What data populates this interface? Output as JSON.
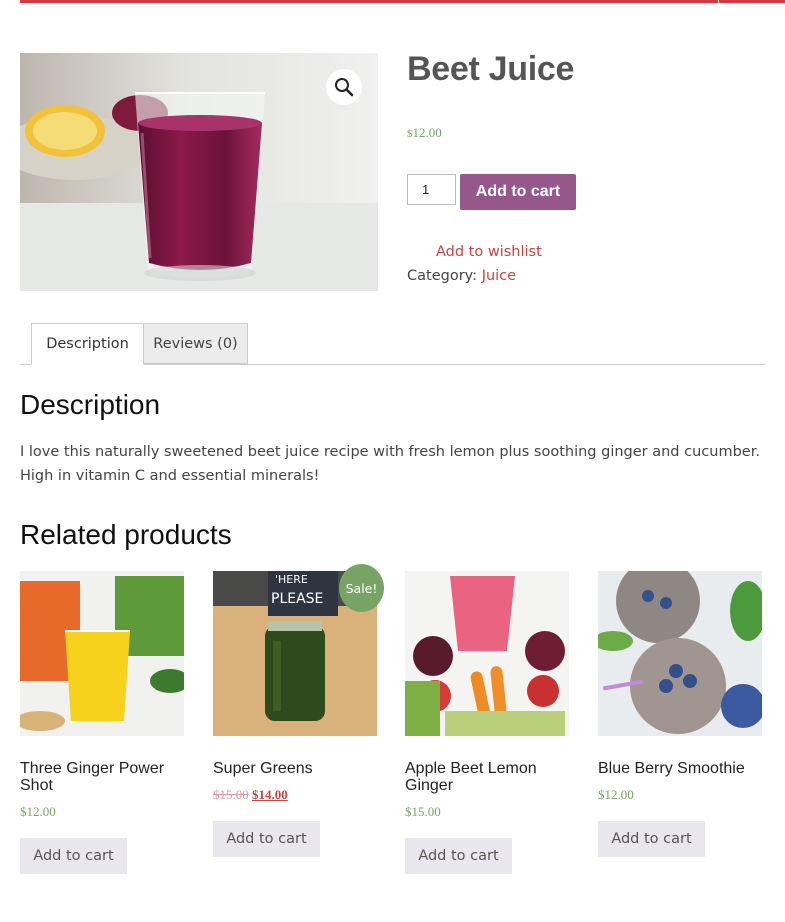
{
  "product": {
    "title": "Beet Juice",
    "price_symbol": "$",
    "price_amount": "12.00",
    "quantity": "1",
    "add_to_cart_label": "Add to cart",
    "wishlist_label": "Add to wishlist",
    "category_label": "Category:",
    "category_value": "Juice"
  },
  "tabs": [
    {
      "label": "Description",
      "active": true
    },
    {
      "label": "Reviews (0)",
      "active": false
    }
  ],
  "description": {
    "heading": "Description",
    "text": "I love this naturally sweetened beet juice recipe with fresh lemon plus soothing ginger and cucumber. High in vitamin C and essential minerals!"
  },
  "related": {
    "heading": "Related products",
    "items": [
      {
        "name": "Three Ginger Power Shot",
        "price": "$12.00",
        "button": "Add to cart"
      },
      {
        "name": "Super Greens",
        "old_price": "$15.00",
        "price": "$14.00",
        "badge": "Sale!",
        "button": "Add to cart"
      },
      {
        "name": "Apple Beet Lemon Ginger",
        "price": "$15.00",
        "button": "Add to cart"
      },
      {
        "name": "Blue Berry Smoothie",
        "price": "$12.00",
        "button": "Add to cart"
      }
    ]
  },
  "colors": {
    "accent_purple": "#96588a",
    "link_red": "#c84343",
    "price_green": "#77a464"
  },
  "icons": {
    "zoom": "magnifier-icon"
  }
}
